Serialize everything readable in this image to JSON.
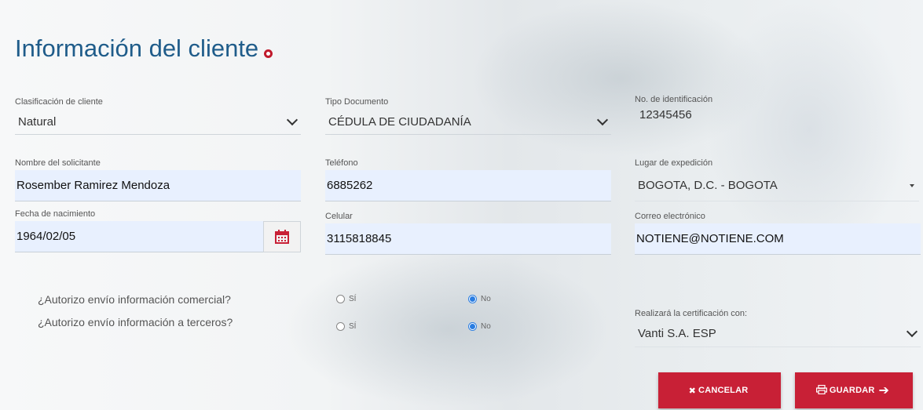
{
  "title": "Información del cliente",
  "fields": {
    "clasificacion": {
      "label": "Clasificación de cliente",
      "value": "Natural"
    },
    "tipo_documento": {
      "label": "Tipo Documento",
      "value": "CÉDULA DE CIUDADANÍA"
    },
    "no_identificacion": {
      "label": "No. de identificación",
      "value": "12345456"
    },
    "nombre": {
      "label": "Nombre del solicitante",
      "value": "Rosember Ramirez Mendoza"
    },
    "telefono": {
      "label": "Teléfono",
      "value": "6885262"
    },
    "lugar_expedicion": {
      "label": "Lugar de expedición",
      "value": "BOGOTA, D.C. - BOGOTA"
    },
    "fecha_nacimiento": {
      "label": "Fecha de nacimiento",
      "value": "1964/02/05"
    },
    "celular": {
      "label": "Celular",
      "value": "3115818845"
    },
    "correo": {
      "label": "Correo electrónico",
      "value": "NOTIENE@NOTIENE.COM"
    },
    "certificacion": {
      "label": "Realizará la certificación con:",
      "value": "Vanti S.A. ESP"
    }
  },
  "questions": [
    {
      "text": "¿Autorizo envío información comercial?",
      "yes_label": "SÍ",
      "no_label": "No",
      "selected": "No"
    },
    {
      "text": "¿Autorizo envío información a terceros?",
      "yes_label": "SÍ",
      "no_label": "No",
      "selected": "No"
    }
  ],
  "buttons": {
    "cancel_label": "CANCELAR",
    "save_label": "GUARDAR"
  },
  "colors": {
    "title": "#1f5c8a",
    "accent": "#c82036",
    "input_bg": "#e8f0fe",
    "radio_selected": "#2a7de1"
  },
  "icons": {
    "title": "info-circle-icon",
    "calendar": "calendar-icon",
    "cancel": "x-icon",
    "save": "print-icon",
    "save_arrow": "arrow-right-icon"
  }
}
